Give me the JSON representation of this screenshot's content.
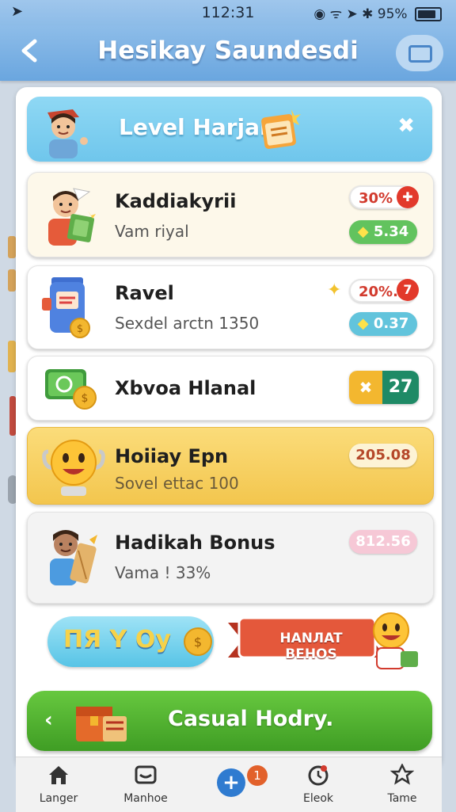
{
  "status_bar": {
    "time": "112:31",
    "battery": "95%"
  },
  "header": {
    "title": "Hesikay Saundesdi"
  },
  "banner": {
    "title": "Level Harjan"
  },
  "cards": [
    {
      "title": "Kaddiakyrii",
      "subtitle": "Vam riyal",
      "badge_top": "30%",
      "badge_bottom": "5.34"
    },
    {
      "title": "Ravel",
      "subtitle": "Sexdel arctn 1350",
      "badge_top": "20%.",
      "badge_top_count": "7",
      "badge_bottom": "0.37"
    },
    {
      "title": "Xbvoa Hlanal",
      "badge_value": "27"
    },
    {
      "title": "Hoiiay Epn",
      "subtitle": "Sovel ettac 100",
      "badge": "205.08"
    },
    {
      "title": "Hadikah Bonus",
      "subtitle": "Vama ! 33%",
      "badge": "812.56"
    }
  ],
  "promo": {
    "left_text": "ПЯ Y Oy",
    "ribbon_text": "HANЛAT BEHOS"
  },
  "cta": {
    "label": "Casual Hodry."
  },
  "bottom_nav": {
    "items": [
      {
        "label": "Langer"
      },
      {
        "label": "Manhoe"
      },
      {
        "label": "",
        "badge": "1"
      },
      {
        "label": "Eleok"
      },
      {
        "label": "Tame"
      }
    ]
  },
  "colors": {
    "header": "#6aa6df",
    "banner": "#7ecdf0",
    "gold_card": "#f8d46c",
    "cta_green": "#4caa2c"
  }
}
